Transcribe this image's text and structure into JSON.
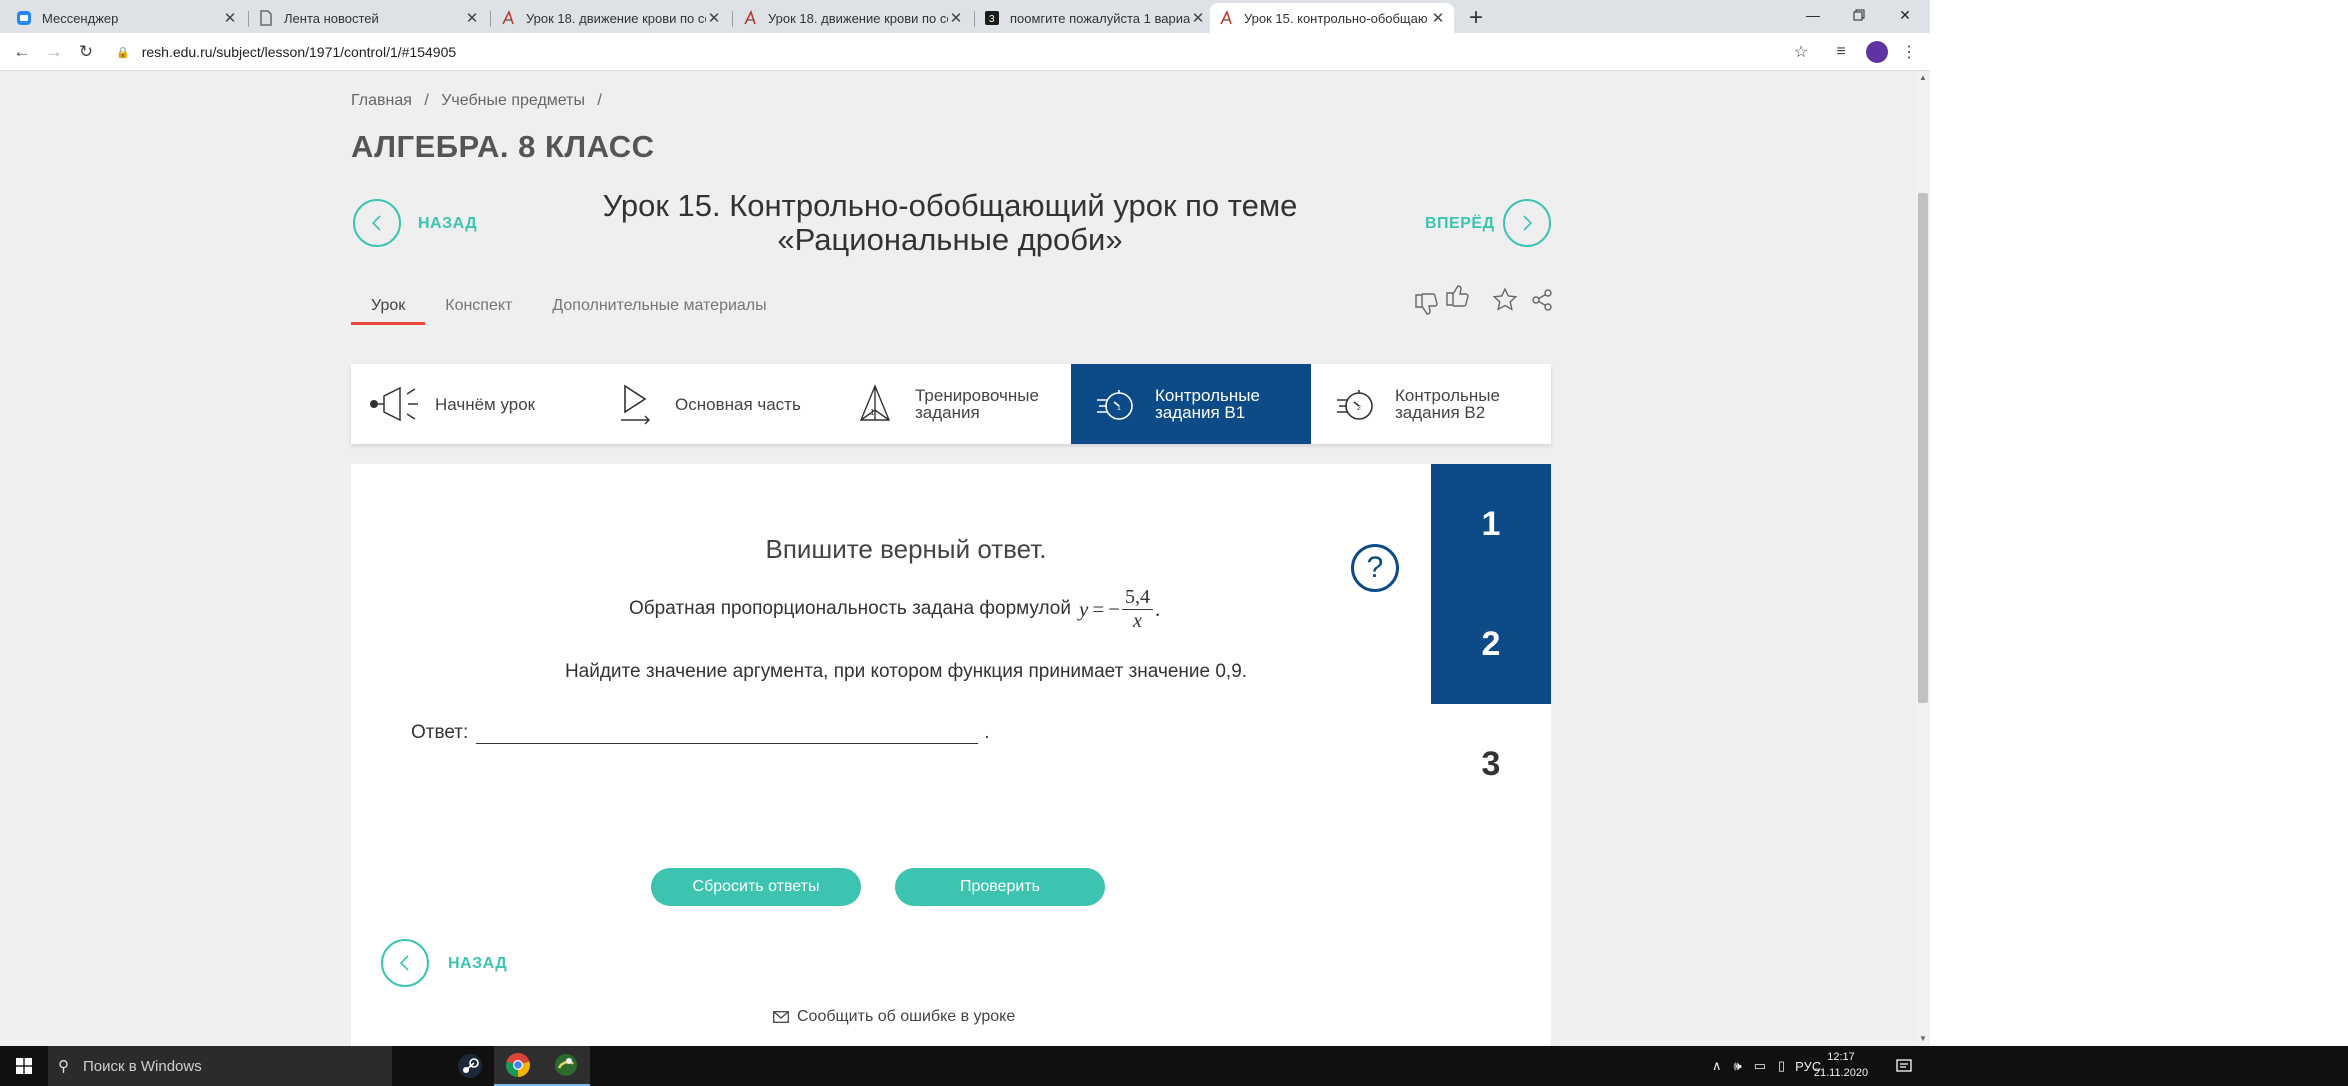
{
  "browser": {
    "tabs": [
      {
        "title": "Мессенджер",
        "favicon": "vk-icon",
        "active": false
      },
      {
        "title": "Лента новостей",
        "favicon": "doc-icon",
        "active": false
      },
      {
        "title": "Урок 18. движение крови по со",
        "favicon": "resh-icon",
        "active": false
      },
      {
        "title": "Урок 18. движение крови по со",
        "favicon": "resh-icon",
        "active": false
      },
      {
        "title": "поомгите пожалуйста 1 вариан",
        "favicon": "znanija-icon",
        "active": false
      },
      {
        "title": "Урок 15. контрольно-обобщаю",
        "favicon": "resh-icon",
        "active": true
      }
    ],
    "url": "resh.edu.ru/subject/lesson/1971/control/1/#154905"
  },
  "page": {
    "breadcrumbs": [
      "Главная",
      "Учебные предметы"
    ],
    "breadcrumb_sep": "/",
    "subject_title": "АЛГЕБРА. 8 КЛАСС",
    "nav_back": "НАЗАД",
    "nav_forward": "ВПЕРЁД",
    "lesson_title_line1": "Урок 15. Контрольно-обобщающий урок по теме",
    "lesson_title_line2": "«Рациональные дроби»",
    "subtabs": [
      "Урок",
      "Конспект",
      "Дополнительные материалы"
    ],
    "steps": [
      {
        "line1": "Начнём урок",
        "line2": ""
      },
      {
        "line1": "Основная часть",
        "line2": ""
      },
      {
        "line1": "Тренировочные",
        "line2": "задания"
      },
      {
        "line1": "Контрольные",
        "line2": "задания В1"
      },
      {
        "line1": "Контрольные",
        "line2": "задания В2"
      }
    ],
    "active_step": 3,
    "instruction": "Впишите верный ответ.",
    "formula_text": "Обратная пропорциональность задана формулой",
    "formula": {
      "lhs": "y",
      "eq": "=",
      "sign": "−",
      "numerator": "5,4",
      "denominator": "x",
      "end": "."
    },
    "question": "Найдите значение аргумента, при котором функция принимает значение 0,9.",
    "answer_label": "Ответ:",
    "answer_value": "",
    "answer_end": ".",
    "question_numbers": [
      "1",
      "2",
      "3"
    ],
    "reset_button": "Сбросить ответы",
    "check_button": "Проверить",
    "bottom_back": "НАЗАД",
    "report_error": "Сообщить об ошибке в уроке"
  },
  "taskbar": {
    "search_placeholder": "Поиск в Windows",
    "language": "РУС",
    "time": "12:17",
    "date": "21.11.2020"
  },
  "colors": {
    "accent_teal": "#3cc4b1",
    "navy": "#0c4b88",
    "tab_underline": "#e94a3b"
  }
}
